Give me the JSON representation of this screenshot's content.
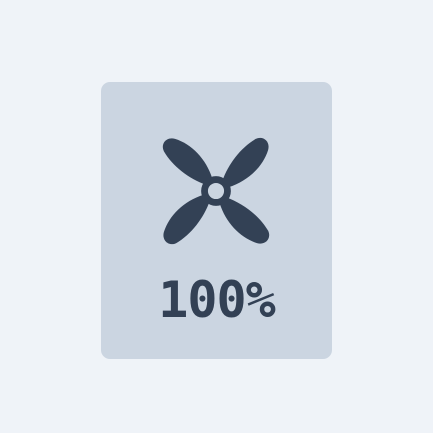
{
  "fan_control": {
    "icon": "fan-icon",
    "speed_percent": 100,
    "speed_label": "100%",
    "colors": {
      "background": "#eff3f8",
      "tile": "#cbd5e1",
      "foreground": "#334155"
    }
  }
}
